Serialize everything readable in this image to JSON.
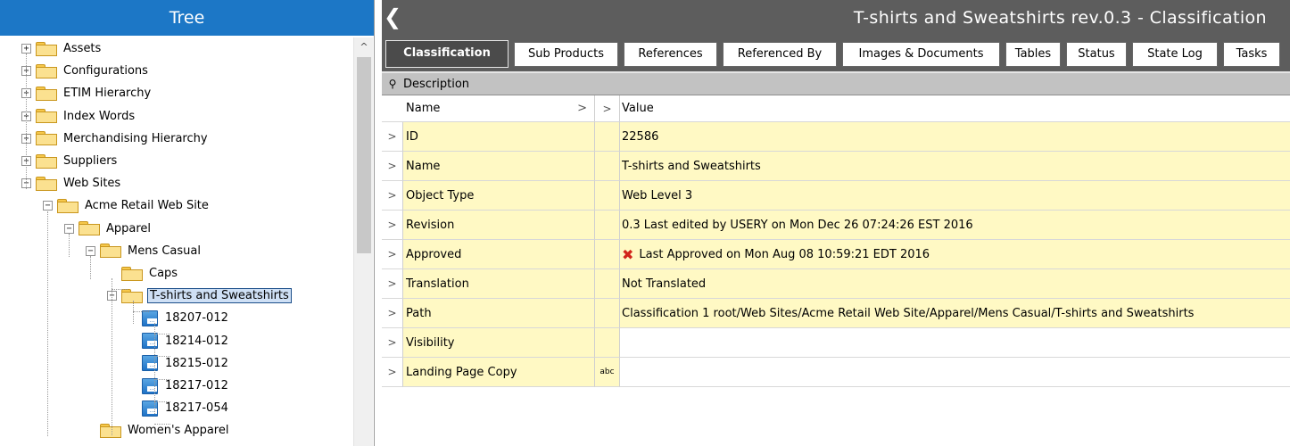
{
  "tree": {
    "title": "Tree",
    "items": [
      {
        "label": "Assets",
        "expander": "+"
      },
      {
        "label": "Configurations",
        "expander": "+"
      },
      {
        "label": "ETIM Hierarchy",
        "expander": "+"
      },
      {
        "label": "Index Words",
        "expander": "+"
      },
      {
        "label": "Merchandising Hierarchy",
        "expander": "+"
      },
      {
        "label": "Suppliers",
        "expander": "+"
      },
      {
        "label": "Web Sites",
        "expander": "−"
      },
      {
        "label": "Acme Retail Web Site",
        "expander": "−"
      },
      {
        "label": "Apparel",
        "expander": "−"
      },
      {
        "label": "Mens Casual",
        "expander": "−"
      },
      {
        "label": "Caps",
        "expander": ""
      },
      {
        "label": "T-shirts and Sweatshirts",
        "expander": "−",
        "selected": true
      },
      {
        "label": "18207-012",
        "expander": ""
      },
      {
        "label": "18214-012",
        "expander": ""
      },
      {
        "label": "18215-012",
        "expander": ""
      },
      {
        "label": "18217-012",
        "expander": ""
      },
      {
        "label": "18217-054",
        "expander": ""
      },
      {
        "label": "Women's Apparel",
        "expander": ""
      }
    ]
  },
  "main": {
    "title": "T-shirts and Sweatshirts rev.0.3 - Classification",
    "tabs": [
      {
        "label": "Classification",
        "active": true
      },
      {
        "label": "Sub Products"
      },
      {
        "label": "References"
      },
      {
        "label": "Referenced By"
      },
      {
        "label": "Images & Documents"
      },
      {
        "label": "Tables"
      },
      {
        "label": "Status"
      },
      {
        "label": "State Log"
      },
      {
        "label": "Tasks"
      }
    ],
    "section_label": "Description",
    "grid_header": {
      "name": "Name",
      "name_arrow": ">",
      "type_arrow": ">",
      "value": "Value"
    },
    "rows": [
      {
        "name": "ID",
        "value": "22586"
      },
      {
        "name": "Name",
        "value": "T-shirts and Sweatshirts"
      },
      {
        "name": "Object Type",
        "value": "Web Level 3"
      },
      {
        "name": "Revision",
        "value": "0.3 Last edited by USERY on Mon Dec 26 07:24:26 EST 2016"
      },
      {
        "name": "Approved",
        "value": "Last Approved on Mon Aug 08 10:59:21 EDT 2016",
        "icon": "reject-icon"
      },
      {
        "name": "Translation",
        "value": "Not Translated"
      },
      {
        "name": "Path",
        "value": "Classification 1 root/Web Sites/Acme Retail Web Site/Apparel/Mens Casual/T-shirts and Sweatshirts"
      },
      {
        "name": "Visibility",
        "value": ""
      },
      {
        "name": "Landing Page Copy",
        "value": "",
        "type": "abc"
      }
    ],
    "row_arrow": ">"
  },
  "colors": {
    "tree_header": "#1c77c6",
    "title_bar": "#5d5d5d",
    "attr_bg": "#fff9c4",
    "selected": "#cfe0f5"
  }
}
